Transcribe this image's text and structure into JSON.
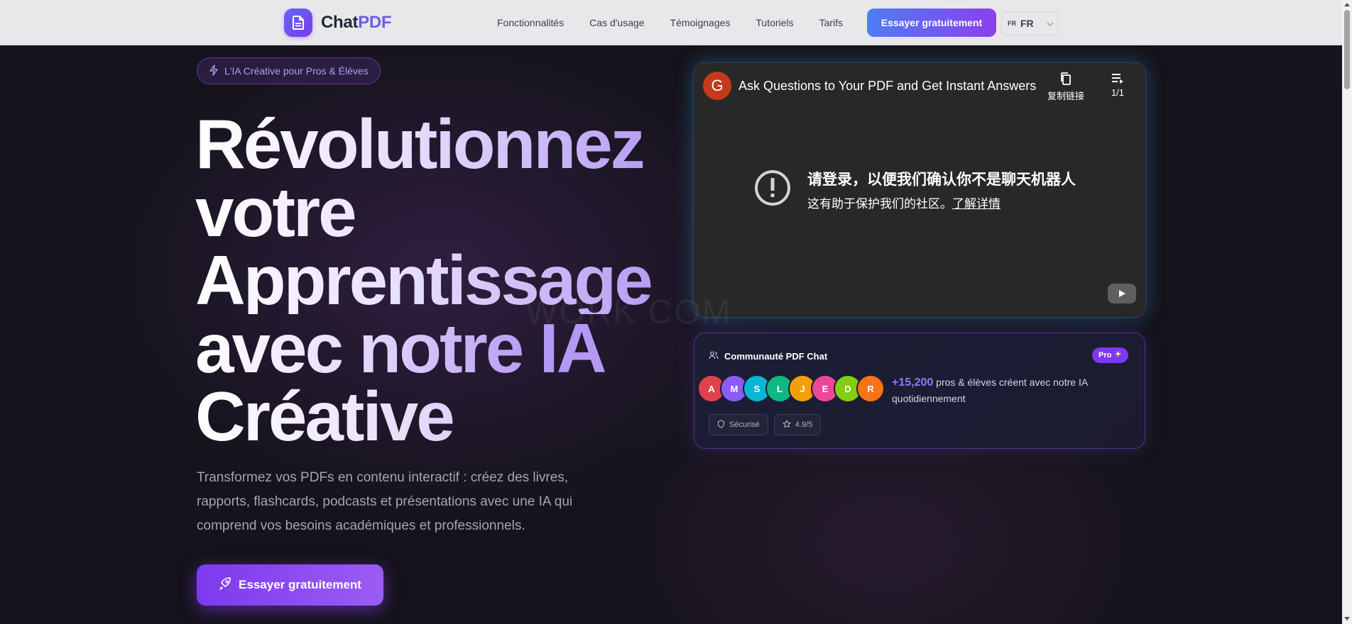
{
  "brand": {
    "name_part1": "Chat",
    "name_part2": "PDF",
    "logo_icon": "document-icon"
  },
  "nav": {
    "links": [
      "Fonctionnalités",
      "Cas d'usage",
      "Témoignages",
      "Tutoriels",
      "Tarifs"
    ],
    "cta_label": "Essayer gratuitement",
    "lang_code": "FR",
    "lang_name": "FR"
  },
  "hero": {
    "badge": "L'IA Créative pour Pros & Élèves",
    "headline_lines": [
      "Révolutionnez",
      "votre",
      "Apprentissage",
      "avec notre ",
      "Créative"
    ],
    "headline_highlight": "IA",
    "subtitle": "Transformez vos PDFs en contenu interactif : créez des livres, rapports, flashcards, podcasts et présentations avec une IA qui comprend vos besoins académiques et professionnels.",
    "cta_label": "Essayer gratuitement"
  },
  "video": {
    "channel_initial": "G",
    "title": "Ask Questions to Your PDF and Get Instant Answers",
    "copy_link_label": "复制链接",
    "playlist_count": "1/1",
    "alert_title": "请登录，以便我们确认你不是聊天机器人",
    "alert_sub": "这有助于保护我们的社区。",
    "alert_link": "了解详情"
  },
  "community": {
    "title": "Communauté PDF Chat",
    "pro_label": "Pro",
    "avatars": [
      {
        "letter": "A",
        "color": "#e0424b"
      },
      {
        "letter": "M",
        "color": "#8b5cf6"
      },
      {
        "letter": "S",
        "color": "#06b6d4"
      },
      {
        "letter": "L",
        "color": "#10b981"
      },
      {
        "letter": "J",
        "color": "#f59e0b"
      },
      {
        "letter": "E",
        "color": "#ec4899"
      },
      {
        "letter": "D",
        "color": "#84cc16"
      },
      {
        "letter": "R",
        "color": "#f97316"
      }
    ],
    "count": "+15,200",
    "text": " pros & élèves créent avec notre IA quotidiennement",
    "secure_label": "Sécurisé",
    "rating_label": "4.9/5"
  },
  "watermark": "WORK COM",
  "colors": {
    "accent": "#7c3aed",
    "nav_cta_start": "#4f7df3",
    "nav_cta_end": "#8b3ff0",
    "highlight": "#b399f5"
  }
}
